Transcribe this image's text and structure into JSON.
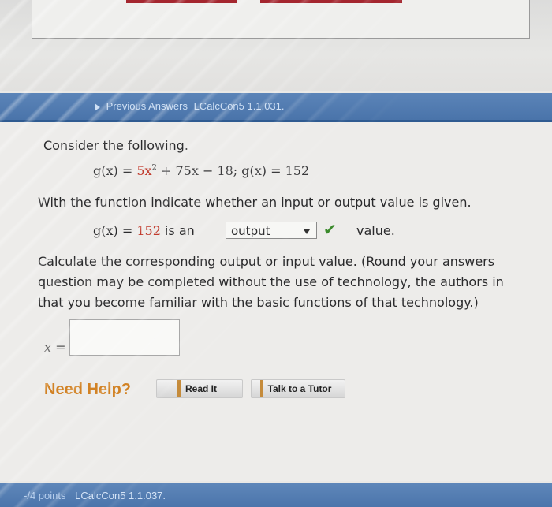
{
  "question_bar": {
    "previous_answers_label": "Previous Answers",
    "problem_id": "LCalcCon5 1.1.031."
  },
  "problem": {
    "prompt": "Consider the following.",
    "equation": {
      "function_name": "g(x) = ",
      "term1": "5x",
      "term1_exp": "2",
      "rest": " + 75x − 18;",
      "condition": "  g(x) = 152"
    },
    "instruction": "With the function indicate whether an input or output value is given.",
    "given": {
      "lhs": "g(x) = ",
      "value": "152",
      "mid": " is an "
    },
    "select": {
      "selected": "output"
    },
    "check_icon": "check-icon",
    "value_word": "value.",
    "calculate_line1": "Calculate the corresponding output or input value. (Round your answers",
    "calculate_line2": "question may be completed without the use of technology, the authors in",
    "calculate_line3": "that you become familiar with the basic functions of that technology.)",
    "x_label": "x =",
    "answer_value": ""
  },
  "help": {
    "need_help": "Need Help?",
    "read_it": "Read It",
    "talk_to_tutor": "Talk to a Tutor"
  },
  "next_question": {
    "points": "-/4 points",
    "problem_id": "LCalcCon5 1.1.037."
  },
  "colors": {
    "accent_blue": "#4a74aa",
    "answer_red": "#c0392b",
    "check_green": "#3b8a2c",
    "help_orange": "#d28224"
  }
}
